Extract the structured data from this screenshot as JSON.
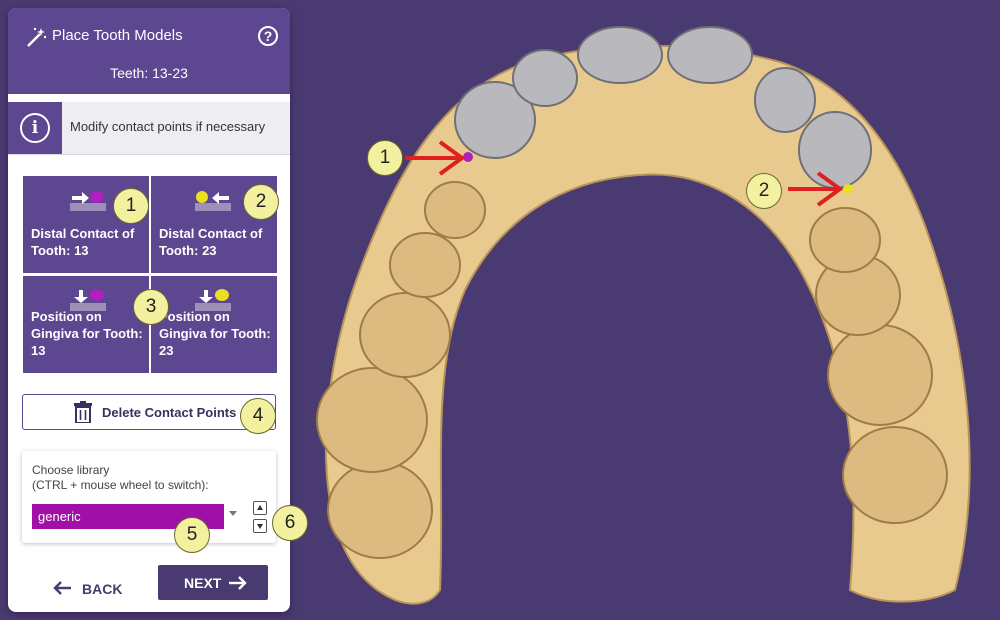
{
  "panel": {
    "title": "Place Tooth Models",
    "teeth_range": "Teeth: 13-23",
    "info_text": "Modify contact points if necessary",
    "tiles": [
      {
        "label": "Distal Contact of Tooth: 13",
        "icon": "distal-contact-right-icon"
      },
      {
        "label": "Distal Contact of Tooth: 23",
        "icon": "distal-contact-left-icon"
      },
      {
        "label": "Position on Gingiva for Tooth: 13",
        "icon": "gingiva-position-icon"
      },
      {
        "label": "Position on Gingiva for Tooth: 23",
        "icon": "gingiva-position-icon"
      }
    ],
    "delete_label": "Delete Contact Points",
    "library": {
      "label": "Choose library\n(CTRL + mouse wheel to switch):",
      "selected": "generic"
    },
    "back_label": "BACK",
    "next_label": "NEXT"
  },
  "callouts": [
    "1",
    "2",
    "3",
    "4",
    "5",
    "6"
  ],
  "viewport_callouts": [
    "1",
    "2"
  ],
  "colors": {
    "header": "#5c4790",
    "background": "#4a3a72",
    "library_select": "#a010a8",
    "callout": "#f3f0a0",
    "contact_point_1": "#b020c0",
    "contact_point_2": "#e8e020",
    "arrow": "#e02020"
  }
}
